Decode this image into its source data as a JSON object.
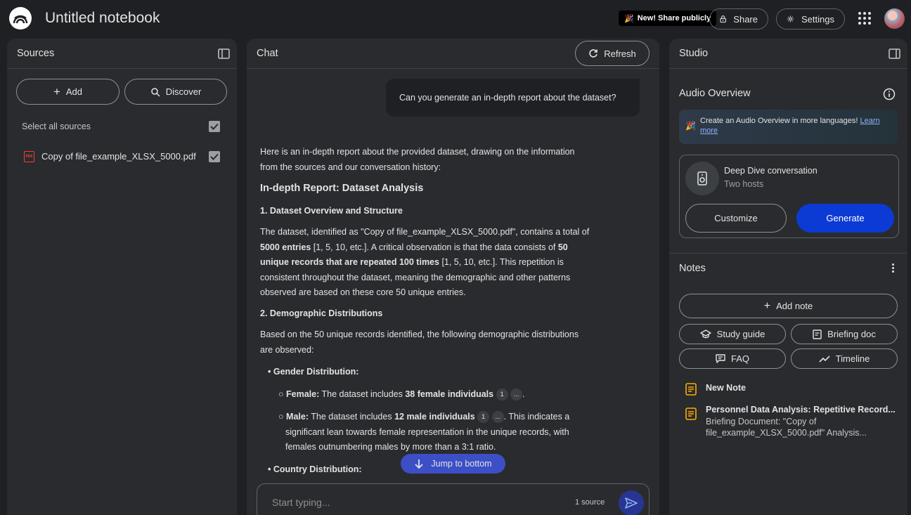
{
  "topbar": {
    "notebook_title": "Untitled notebook",
    "new_badge": "New! Share publicly",
    "share_label": "Share",
    "settings_label": "Settings"
  },
  "sources": {
    "title": "Sources",
    "add_label": "Add",
    "discover_label": "Discover",
    "select_all_label": "Select all sources",
    "items": [
      {
        "name": "Copy of file_example_XLSX_5000.pdf",
        "type_badge": "PDF",
        "checked": true
      }
    ]
  },
  "chat": {
    "title": "Chat",
    "refresh_label": "Refresh",
    "user_message": "Can you generate an in-depth report about the dataset?",
    "response": {
      "intro": "Here is an in-depth report about the provided dataset, drawing on the information from the sources and our conversation history:",
      "heading": "In-depth Report: Dataset Analysis",
      "section1_title": "1. Dataset Overview and Structure",
      "section1_p1": "The dataset, identified as \"Copy of file_example_XLSX_5000.pdf\", contains a total of ",
      "section1_b1": "5000 entries",
      "section1_p2": " [1, 5, 10, etc.]. A critical observation is that the data consists of ",
      "section1_b2": "50 unique records that are repeated 100 times",
      "section1_p3": " [1, 5, 10, etc.]. This repetition is consistent throughout the dataset, meaning the demographic and other patterns observed are based on these core 50 unique entries.",
      "section2_title": "2. Demographic Distributions",
      "section2_intro": "Based on the 50 unique records identified, the following demographic distributions are observed:",
      "gender_label": "Gender Distribution:",
      "female_label": "Female:",
      "female_text": " The dataset includes ",
      "female_bold": "38 female individuals",
      "male_label": "Male:",
      "male_text": " The dataset includes ",
      "male_bold": "12 male individuals",
      "male_rest": ". This indicates a significant lean towards female representation in the unique records, with females outnumbering males by more than a 3:1 ratio.",
      "country_label": "Country Distribution:",
      "cite_num": "1",
      "cite_more": "..."
    },
    "jump_label": "Jump to bottom",
    "input_placeholder": "Start typing...",
    "source_count": "1 source"
  },
  "studio": {
    "title": "Studio",
    "audio_title": "Audio Overview",
    "banner_text": "Create an Audio Overview in more languages! ",
    "banner_link": "Learn more",
    "deep_dive_title": "Deep Dive conversation",
    "deep_dive_sub": "Two hosts",
    "customize_label": "Customize",
    "generate_label": "Generate",
    "notes_title": "Notes",
    "add_note_label": "Add note",
    "study_guide_label": "Study guide",
    "briefing_doc_label": "Briefing doc",
    "faq_label": "FAQ",
    "timeline_label": "Timeline",
    "notes": [
      {
        "title": "New Note",
        "body": ""
      },
      {
        "title": "Personnel Data Analysis: Repetitive Record...",
        "body": "Briefing Document: \"Copy of file_example_XLSX_5000.pdf\" Analysis..."
      }
    ]
  },
  "colors": {
    "background": "#1f2023",
    "panel": "#2a2b2e",
    "primary_button": "#0b3bd4",
    "jump_button": "#3c4fc7",
    "note_icon": "#f9ab00",
    "pdf_icon": "#ea4335"
  }
}
